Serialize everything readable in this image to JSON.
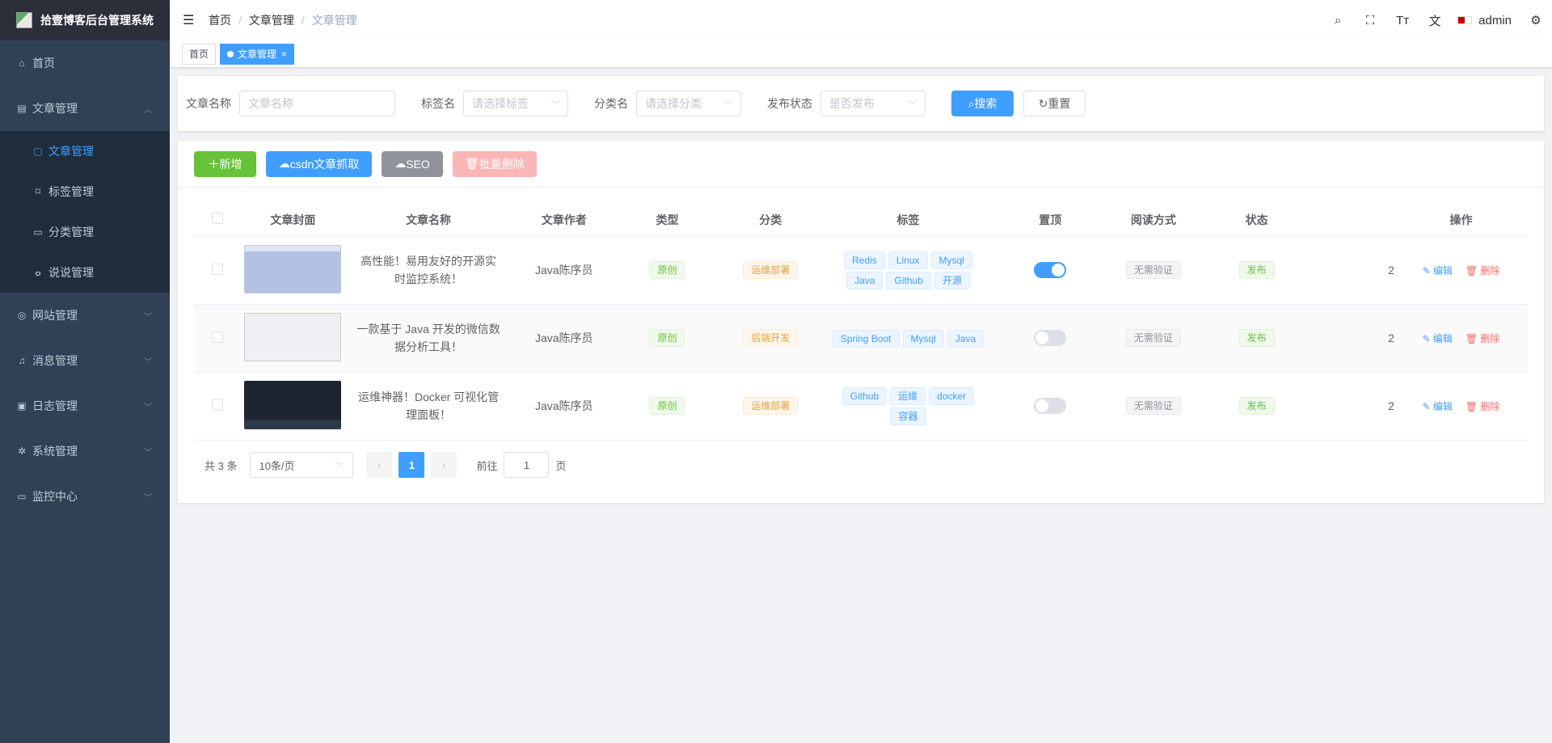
{
  "app": {
    "title": "拾壹博客后台管理系统"
  },
  "sidebar": {
    "items": [
      {
        "label": "首页",
        "icon": "home-icon"
      },
      {
        "label": "文章管理",
        "icon": "document-icon",
        "expanded": true,
        "children": [
          {
            "label": "文章管理",
            "icon": "file-icon",
            "active": true
          },
          {
            "label": "标签管理",
            "icon": "bookmark-icon"
          },
          {
            "label": "分类管理",
            "icon": "folder-icon"
          },
          {
            "label": "说说管理",
            "icon": "bike-icon"
          }
        ]
      },
      {
        "label": "网站管理",
        "icon": "globe-icon"
      },
      {
        "label": "消息管理",
        "icon": "bell-icon"
      },
      {
        "label": "日志管理",
        "icon": "log-icon"
      },
      {
        "label": "系统管理",
        "icon": "gear-icon"
      },
      {
        "label": "监控中心",
        "icon": "monitor-icon"
      }
    ]
  },
  "navbar": {
    "breadcrumb": [
      "首页",
      "文章管理",
      "文章管理"
    ],
    "user": "admin"
  },
  "tags_view": {
    "tabs": [
      "首页",
      "文章管理"
    ]
  },
  "search": {
    "title_label": "文章名称",
    "title_placeholder": "文章名称",
    "tag_label": "标签名",
    "tag_placeholder": "请选择标签",
    "category_label": "分类名",
    "category_placeholder": "请选择分类",
    "status_label": "发布状态",
    "status_placeholder": "是否发布",
    "search_btn": "搜索",
    "reset_btn": "重置"
  },
  "toolbar": {
    "add": "新增",
    "csdn": "csdn文章抓取",
    "seo": "SEO",
    "batch_delete": "批量删除"
  },
  "table": {
    "columns": [
      "文章封面",
      "文章名称",
      "文章作者",
      "类型",
      "分类",
      "标签",
      "置顶",
      "阅读方式",
      "状态",
      "操作"
    ],
    "rows": [
      {
        "title": "高性能！易用友好的开源实时监控系统！",
        "author": "Java陈序员",
        "type": "原创",
        "category": "运维部署",
        "tags": [
          "Redis",
          "Linux",
          "Mysql",
          "Java",
          "Github",
          "开源"
        ],
        "top": true,
        "read": "无需验证",
        "status": "发布",
        "extra": "2",
        "edit": "编辑",
        "delete": "删除"
      },
      {
        "title": "一款基于 Java 开发的微信数据分析工具！",
        "author": "Java陈序员",
        "type": "原创",
        "category": "后端开发",
        "tags": [
          "Spring Boot",
          "Mysql",
          "Java"
        ],
        "top": false,
        "read": "无需验证",
        "status": "发布",
        "extra": "2",
        "edit": "编辑",
        "delete": "删除"
      },
      {
        "title": "运维神器！Docker 可视化管理面板！",
        "author": "Java陈序员",
        "type": "原创",
        "category": "运维部署",
        "tags": [
          "Github",
          "运维",
          "docker",
          "容器"
        ],
        "top": false,
        "read": "无需验证",
        "status": "发布",
        "extra": "2",
        "edit": "编辑",
        "delete": "删除"
      }
    ]
  },
  "pagination": {
    "total": "共 3 条",
    "page_size": "10条/页",
    "current": "1",
    "goto_label": "前往",
    "goto_value": "1",
    "page_suffix": "页"
  }
}
